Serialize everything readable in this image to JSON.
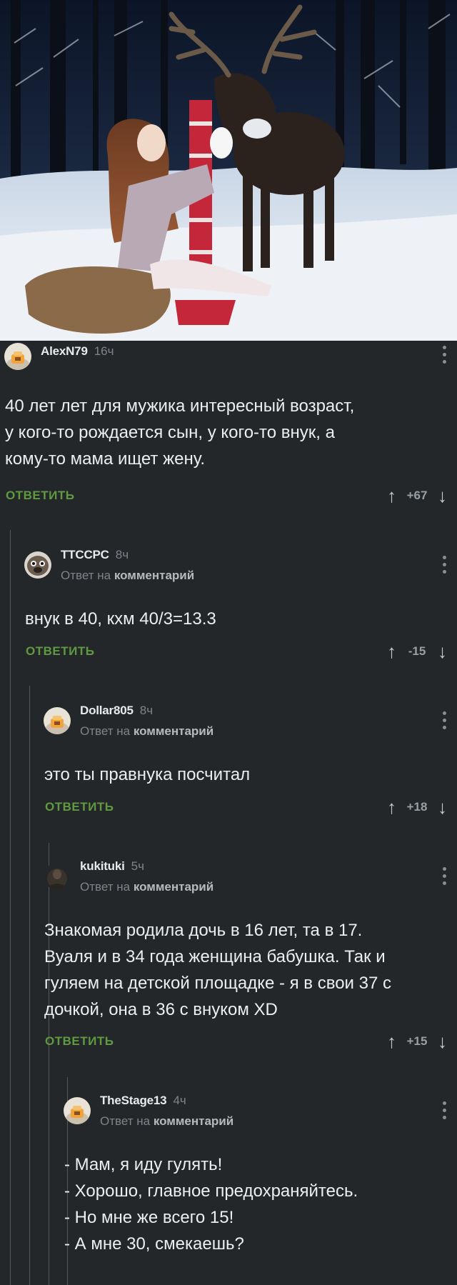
{
  "post": {
    "image_alt": "girl-with-reindeer-in-winter-forest"
  },
  "comments": [
    {
      "nick": "AlexN79",
      "time": "16ч",
      "reply_prefix": "",
      "reply_target": "",
      "lines": [
        "40 лет лет для мужика интересный возраст,",
        "у кого-то рождается сын, у кого-то внук, а",
        "кому-то мама ищет жену."
      ],
      "reply_label": "ОТВЕТИТЬ",
      "score": "+67"
    },
    {
      "nick": "TTCCPC",
      "time": "8ч",
      "reply_prefix": "Ответ на ",
      "reply_target": "комментарий",
      "lines": [
        "внук в 40, кхм 40/3=13.3"
      ],
      "reply_label": "ОТВЕТИТЬ",
      "score": "-15"
    },
    {
      "nick": "Dollar805",
      "time": "8ч",
      "reply_prefix": "Ответ на ",
      "reply_target": "комментарий",
      "lines": [
        "это ты правнука посчитал"
      ],
      "reply_label": "ОТВЕТИТЬ",
      "score": "+18"
    },
    {
      "nick": "kukituki",
      "time": "5ч",
      "reply_prefix": "Ответ на ",
      "reply_target": "комментарий",
      "lines": [
        "Знакомая родила дочь в 16 лет, та в 17.",
        "Вуаля и в 34 года женщина бабушка. Так и",
        "гуляем на детской площадке - я в свои 37 с",
        "дочкой, она в 36 с внуком XD"
      ],
      "reply_label": "ОТВЕТИТЬ",
      "score": "+15"
    },
    {
      "nick": "TheStage13",
      "time": "4ч",
      "reply_prefix": "Ответ на ",
      "reply_target": "комментарий",
      "lines": [
        "- Мам, я иду гулять!",
        "- Хорошо, главное предохраняйтесь.",
        "- Но мне же всего 15!",
        "- А мне 30, смекаешь?"
      ]
    }
  ],
  "colors": {
    "background": "#24272a",
    "reply_green": "#5f9a40",
    "muted_text": "#7f8488"
  },
  "icons": {
    "upvote": "arrow-up-icon",
    "downvote": "arrow-down-icon",
    "menu": "kebab-menu-icon",
    "default_avatar": "pikabu-default-avatar"
  }
}
